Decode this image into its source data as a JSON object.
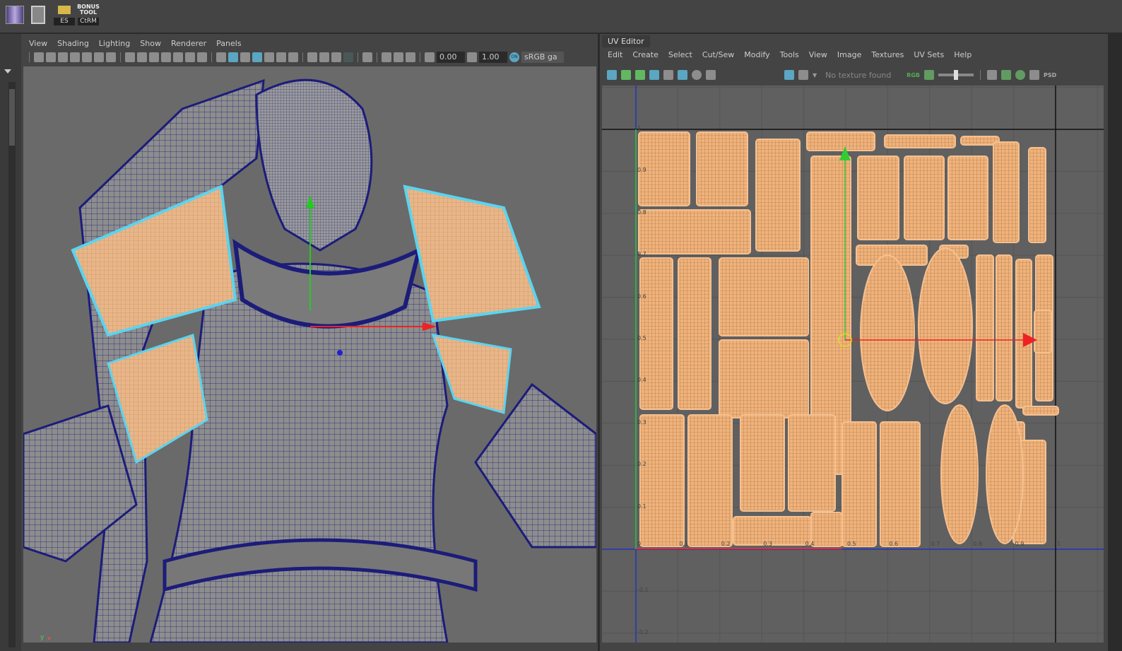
{
  "shelf": {
    "items": [
      {
        "icon": "split-panel-icon"
      },
      {
        "icon": "copy-layout-icon"
      },
      {
        "icon": "folder-icon",
        "label": "ES"
      },
      {
        "icon": "bonus-tools-icon",
        "title": "BONUS TOOL",
        "label": "CtRM"
      }
    ]
  },
  "viewport": {
    "menu": [
      "View",
      "Shading",
      "Lighting",
      "Show",
      "Renderer",
      "Panels"
    ],
    "exposure": "0.00",
    "gamma": "1.00",
    "color_mgmt": "ON",
    "color_space": "sRGB ga",
    "axis": {
      "y": "y",
      "x": "x"
    }
  },
  "uv_editor": {
    "title": "UV Editor",
    "menu": [
      "Edit",
      "Create",
      "Select",
      "Cut/Sew",
      "Modify",
      "Tools",
      "View",
      "Image",
      "Textures",
      "UV Sets",
      "Help"
    ],
    "texture_status": "No texture found",
    "rgb_label": "RGB",
    "psd_label": "PSD",
    "u_ticks": [
      "0",
      "0.1",
      "0.2",
      "0.3",
      "0.4",
      "0.5",
      "0.6",
      "0.7",
      "0.8",
      "0.9",
      "1"
    ],
    "v_ticks": [
      "1",
      "0.9",
      "0.8",
      "0.7",
      "0.6",
      "0.5",
      "0.4",
      "0.3",
      "0.2",
      "0.1",
      "-0.1",
      "-0.2"
    ]
  },
  "colors": {
    "uv_shell": "#f0b27a",
    "wire": "#1c1c7a",
    "select": "#5ad4f0",
    "bg": "#606060"
  }
}
